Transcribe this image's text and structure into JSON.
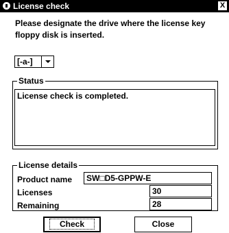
{
  "window": {
    "title": "License check",
    "close_label": "X"
  },
  "instruction": "Please designate the drive where the license key floppy disk is inserted.",
  "drive": {
    "selected": "[-a-]"
  },
  "status": {
    "label": "Status",
    "text": "License check is completed."
  },
  "details": {
    "label": "License details",
    "product_name_label": "Product name",
    "product_name_value": "SW□D5-GPPW-E",
    "licenses_label": "Licenses",
    "licenses_value": "30",
    "remaining_label": "Remaining",
    "remaining_value": "28"
  },
  "buttons": {
    "check": "Check",
    "close": "Close"
  }
}
